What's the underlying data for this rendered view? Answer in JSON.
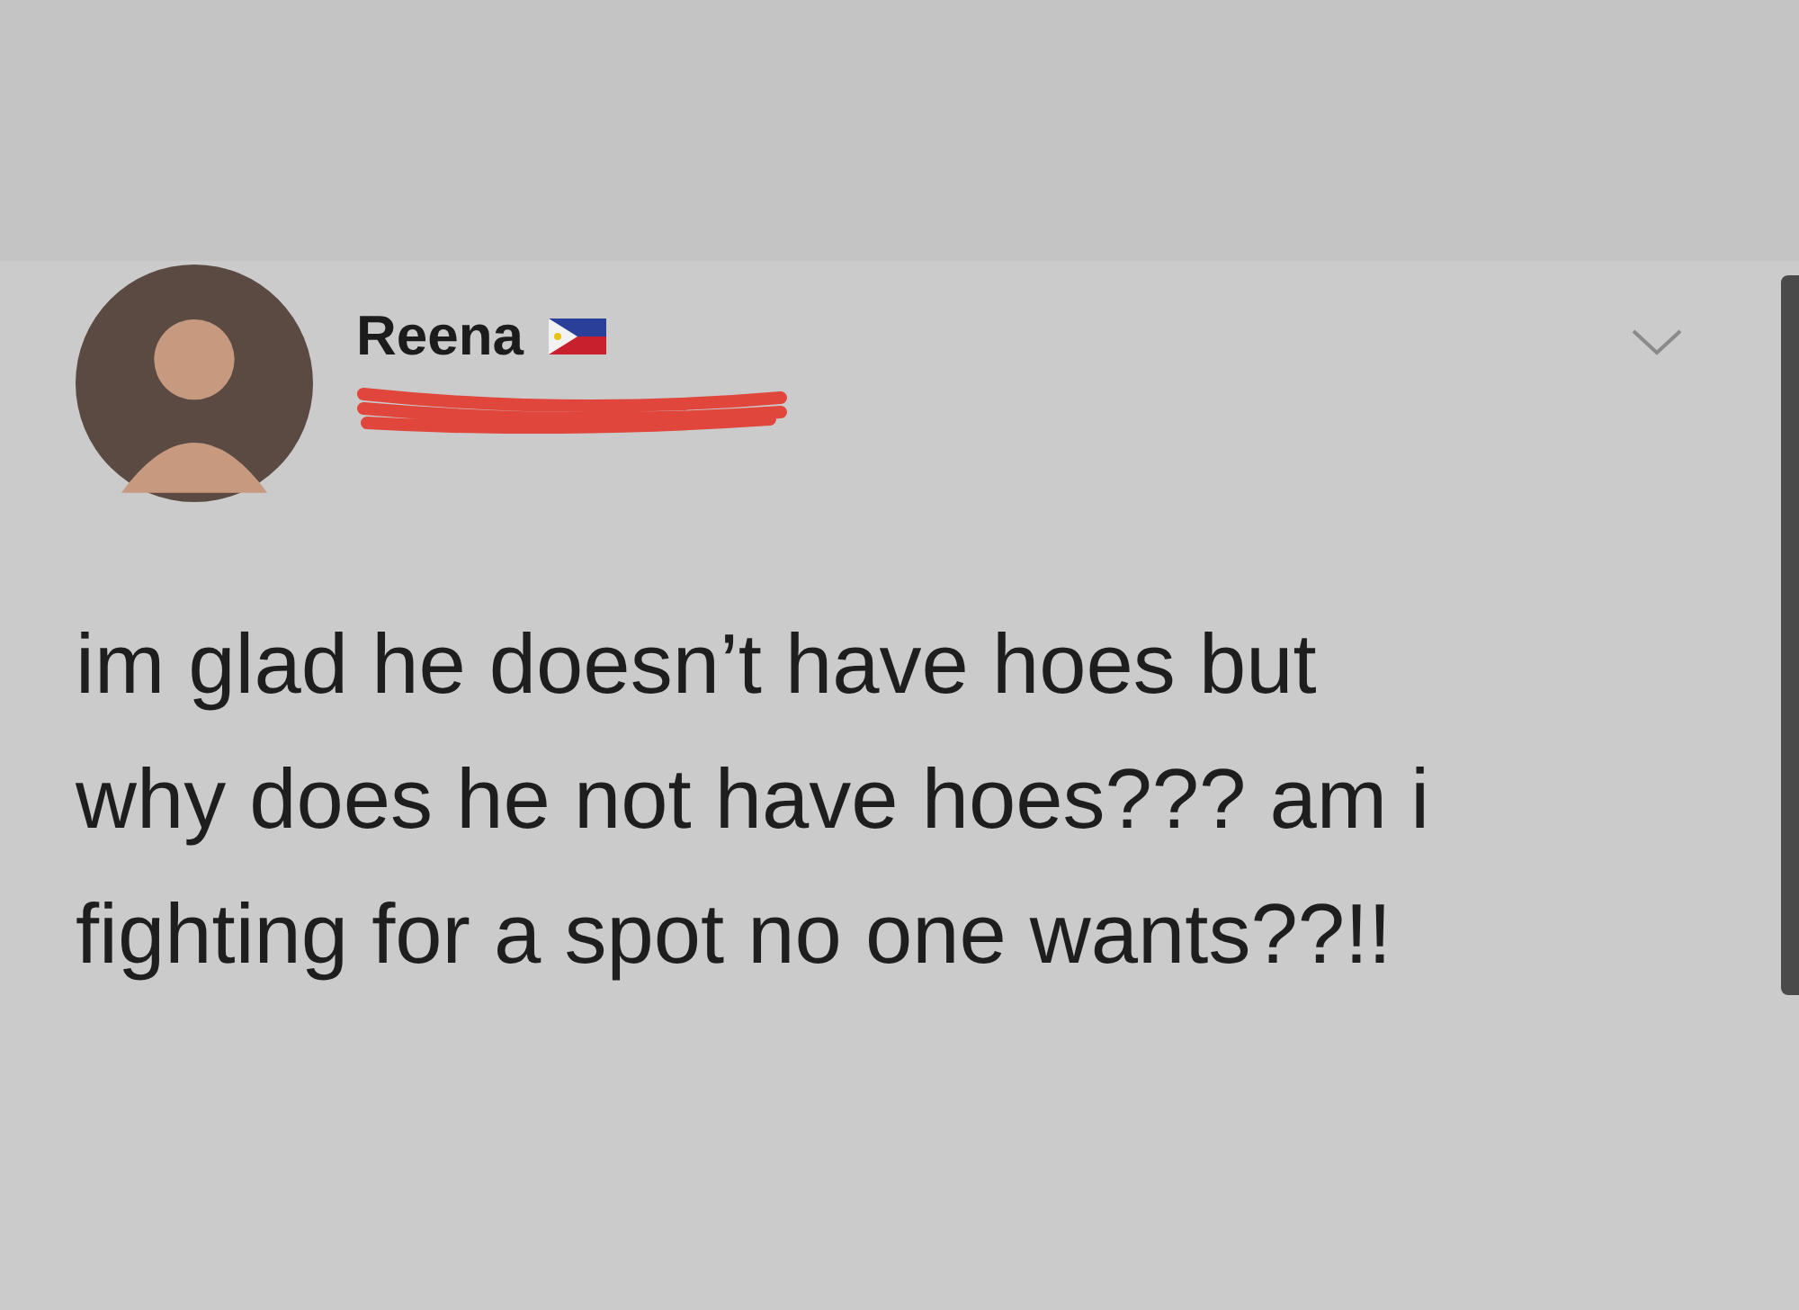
{
  "tweet": {
    "name": "Reena",
    "handle_redacted": true,
    "text": "im glad he doesn’t have hoes but\nwhy does he not have hoes??? am i\nfighting for a spot no one wants??!!"
  }
}
